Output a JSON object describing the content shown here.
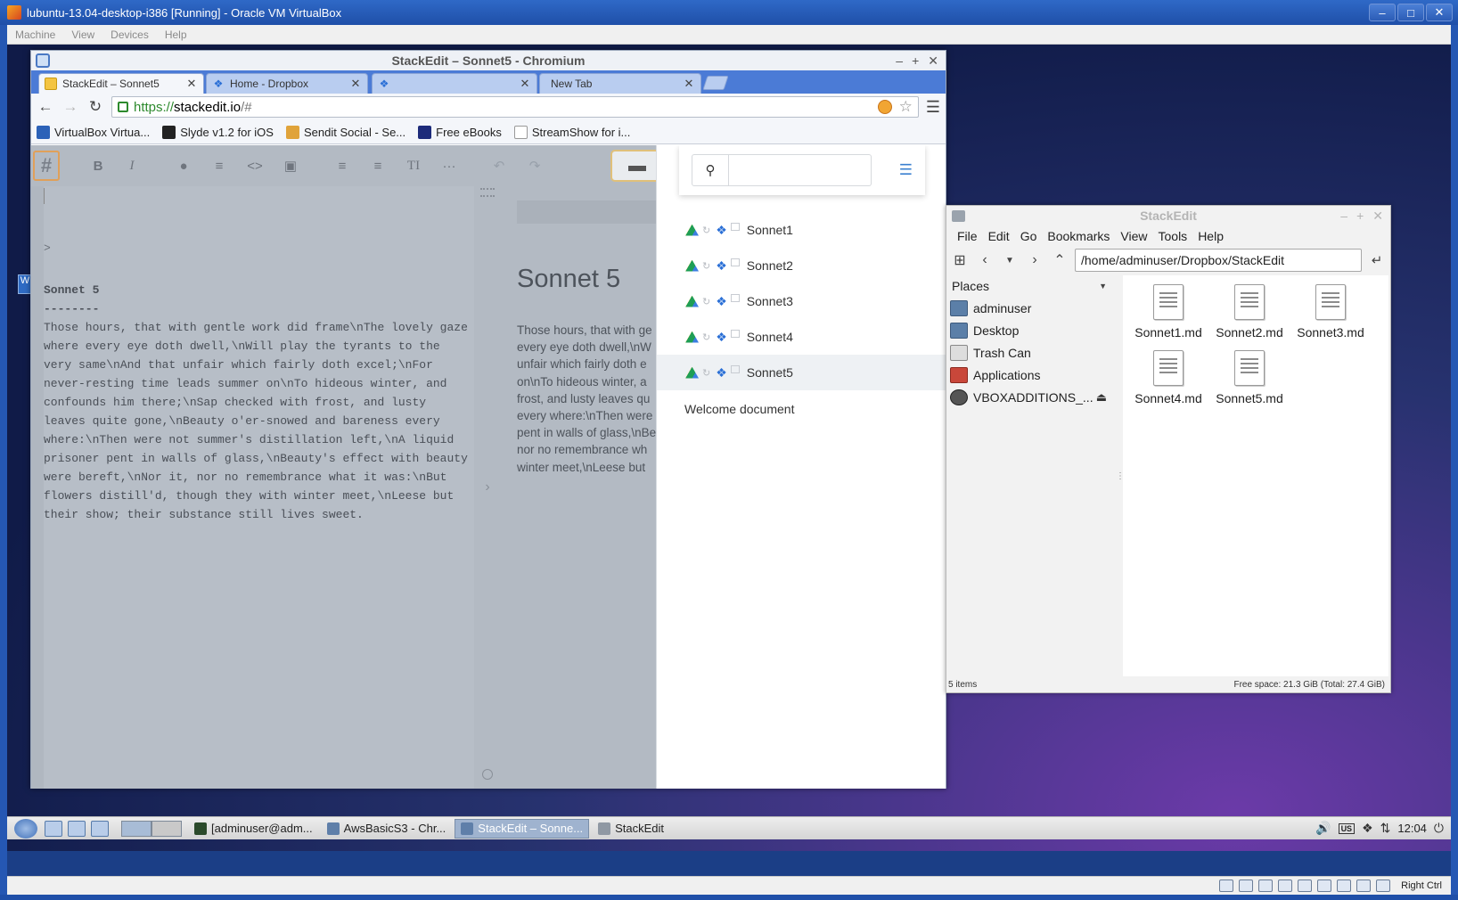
{
  "host_window": {
    "title": "lubuntu-13.04-desktop-i386 [Running] - Oracle VM VirtualBox",
    "menu": [
      "Machine",
      "View",
      "Devices",
      "Help"
    ],
    "host_key": "Right Ctrl"
  },
  "browser": {
    "title": "StackEdit – Sonnet5 - Chromium",
    "tabs": [
      {
        "label": "StackEdit – Sonnet5",
        "active": true
      },
      {
        "label": "Home - Dropbox",
        "active": false
      },
      {
        "label": "",
        "active": false
      },
      {
        "label": "New Tab",
        "active": false
      }
    ],
    "url": {
      "scheme": "https://",
      "host": "stackedit.io",
      "path": "/#"
    },
    "bookmarks": [
      "VirtualBox Virtua...",
      "Slyde v1.2 for iOS",
      "Sendit Social - Se...",
      "Free eBooks",
      "StreamShow for i..."
    ]
  },
  "stackedit": {
    "toolbar": {
      "hash": "#",
      "bold": "B",
      "italic": "I",
      "heading": "TI",
      "more": "···"
    },
    "editor": {
      "quote": ">",
      "heading": "Sonnet 5",
      "underline": "--------",
      "lines": [
        "Those hours, that with gentle work did frame\\nThe lovely gaze",
        "where every eye doth dwell,\\nWill play the tyrants to the",
        "very same\\nAnd that unfair which fairly doth excel;\\nFor",
        "never-resting time leads summer on\\nTo hideous winter, and",
        "confounds him there;\\nSap checked with frost, and lusty",
        "leaves quite gone,\\nBeauty o'er-snowed and bareness every",
        "where:\\nThen were not summer's distillation left,\\nA liquid",
        "prisoner pent in walls of glass,\\nBeauty's effect with beauty",
        "were bereft,\\nNor it, nor no remembrance what it was:\\nBut",
        "flowers distill'd, though they with winter meet,\\nLeese but",
        "their show; their substance still lives sweet."
      ]
    },
    "preview": {
      "title": "Sonnet 5",
      "lines": [
        "Those hours, that with ge",
        "every eye doth dwell,\\nW",
        "unfair which fairly doth e",
        "on\\nTo hideous winter, a",
        "frost, and lusty leaves qu",
        "every where:\\nThen were",
        "pent in walls of glass,\\nBe",
        "nor no remembrance wh",
        "winter meet,\\nLeese but"
      ]
    },
    "documents": [
      {
        "name": "Sonnet1",
        "selected": false
      },
      {
        "name": "Sonnet2",
        "selected": false
      },
      {
        "name": "Sonnet3",
        "selected": false
      },
      {
        "name": "Sonnet4",
        "selected": false
      },
      {
        "name": "Sonnet5",
        "selected": true
      }
    ],
    "welcome_document": "Welcome document"
  },
  "file_manager": {
    "title": "StackEdit",
    "menu": [
      "File",
      "Edit",
      "Go",
      "Bookmarks",
      "View",
      "Tools",
      "Help"
    ],
    "path": "/home/adminuser/Dropbox/StackEdit",
    "places_header": "Places",
    "places": [
      "adminuser",
      "Desktop",
      "Trash Can",
      "Applications",
      "VBOXADDITIONS_..."
    ],
    "files": [
      "Sonnet1.md",
      "Sonnet2.md",
      "Sonnet3.md",
      "Sonnet4.md",
      "Sonnet5.md"
    ],
    "status_items": "5 items",
    "status_space": "Free space: 21.3 GiB (Total: 27.4 GiB)"
  },
  "taskbar": {
    "tasks": [
      {
        "label": "[adminuser@adm...",
        "active": false
      },
      {
        "label": "AwsBasicS3 - Chr...",
        "active": false
      },
      {
        "label": "StackEdit – Sonne...",
        "active": true
      },
      {
        "label": "StackEdit",
        "active": false
      }
    ],
    "keyboard": "US",
    "clock": "12:04"
  },
  "colors": {
    "host_titlebar": "#2f69c7",
    "browser_tabstrip": "#4b7bd6",
    "url_scheme": "#2d8a2d",
    "stackedit_layers_icon": "#3a80d0"
  }
}
